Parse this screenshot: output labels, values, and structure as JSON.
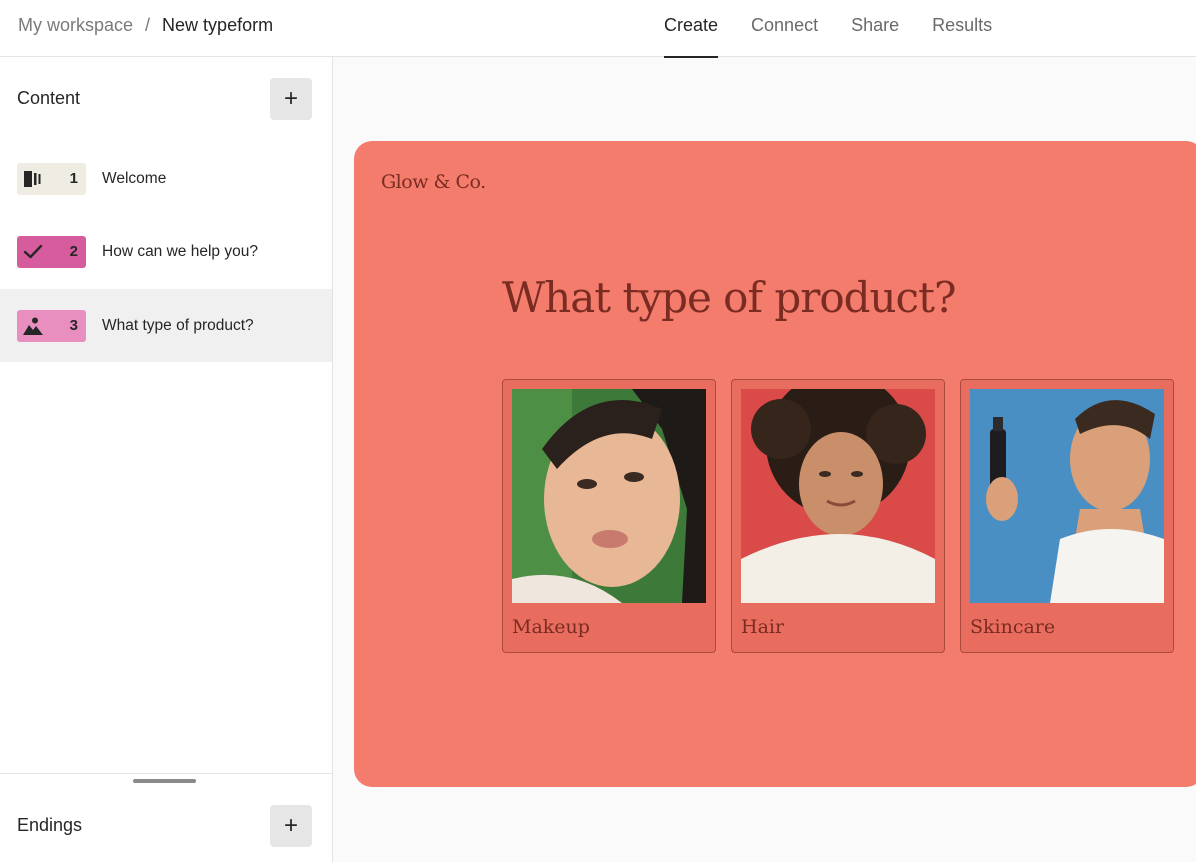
{
  "breadcrumb": {
    "workspace": "My workspace",
    "separator": "/",
    "current": "New typeform"
  },
  "tabs": [
    {
      "label": "Create",
      "active": true
    },
    {
      "label": "Connect",
      "active": false
    },
    {
      "label": "Share",
      "active": false
    },
    {
      "label": "Results",
      "active": false
    }
  ],
  "sidebar": {
    "content_title": "Content",
    "add_label": "+",
    "questions": [
      {
        "number": "1",
        "label": "Welcome",
        "icon": "welcome-screen-icon",
        "color": "#eeece3"
      },
      {
        "number": "2",
        "label": "How can we help you?",
        "icon": "checkmark-icon",
        "color": "#d65c9e"
      },
      {
        "number": "3",
        "label": "What type of product?",
        "icon": "picture-choice-icon",
        "color": "#e98fc0"
      }
    ],
    "endings_title": "Endings",
    "endings_add_label": "+"
  },
  "form": {
    "brand": "Glow & Co.",
    "question": "What type of product?",
    "background_color": "#f47c6c",
    "text_color": "#7a2c22",
    "choices": [
      {
        "label": "Makeup",
        "photo": "woman with green background"
      },
      {
        "label": "Hair",
        "photo": "woman with curly hair"
      },
      {
        "label": "Skincare",
        "photo": "man spraying skincare mist"
      }
    ]
  }
}
